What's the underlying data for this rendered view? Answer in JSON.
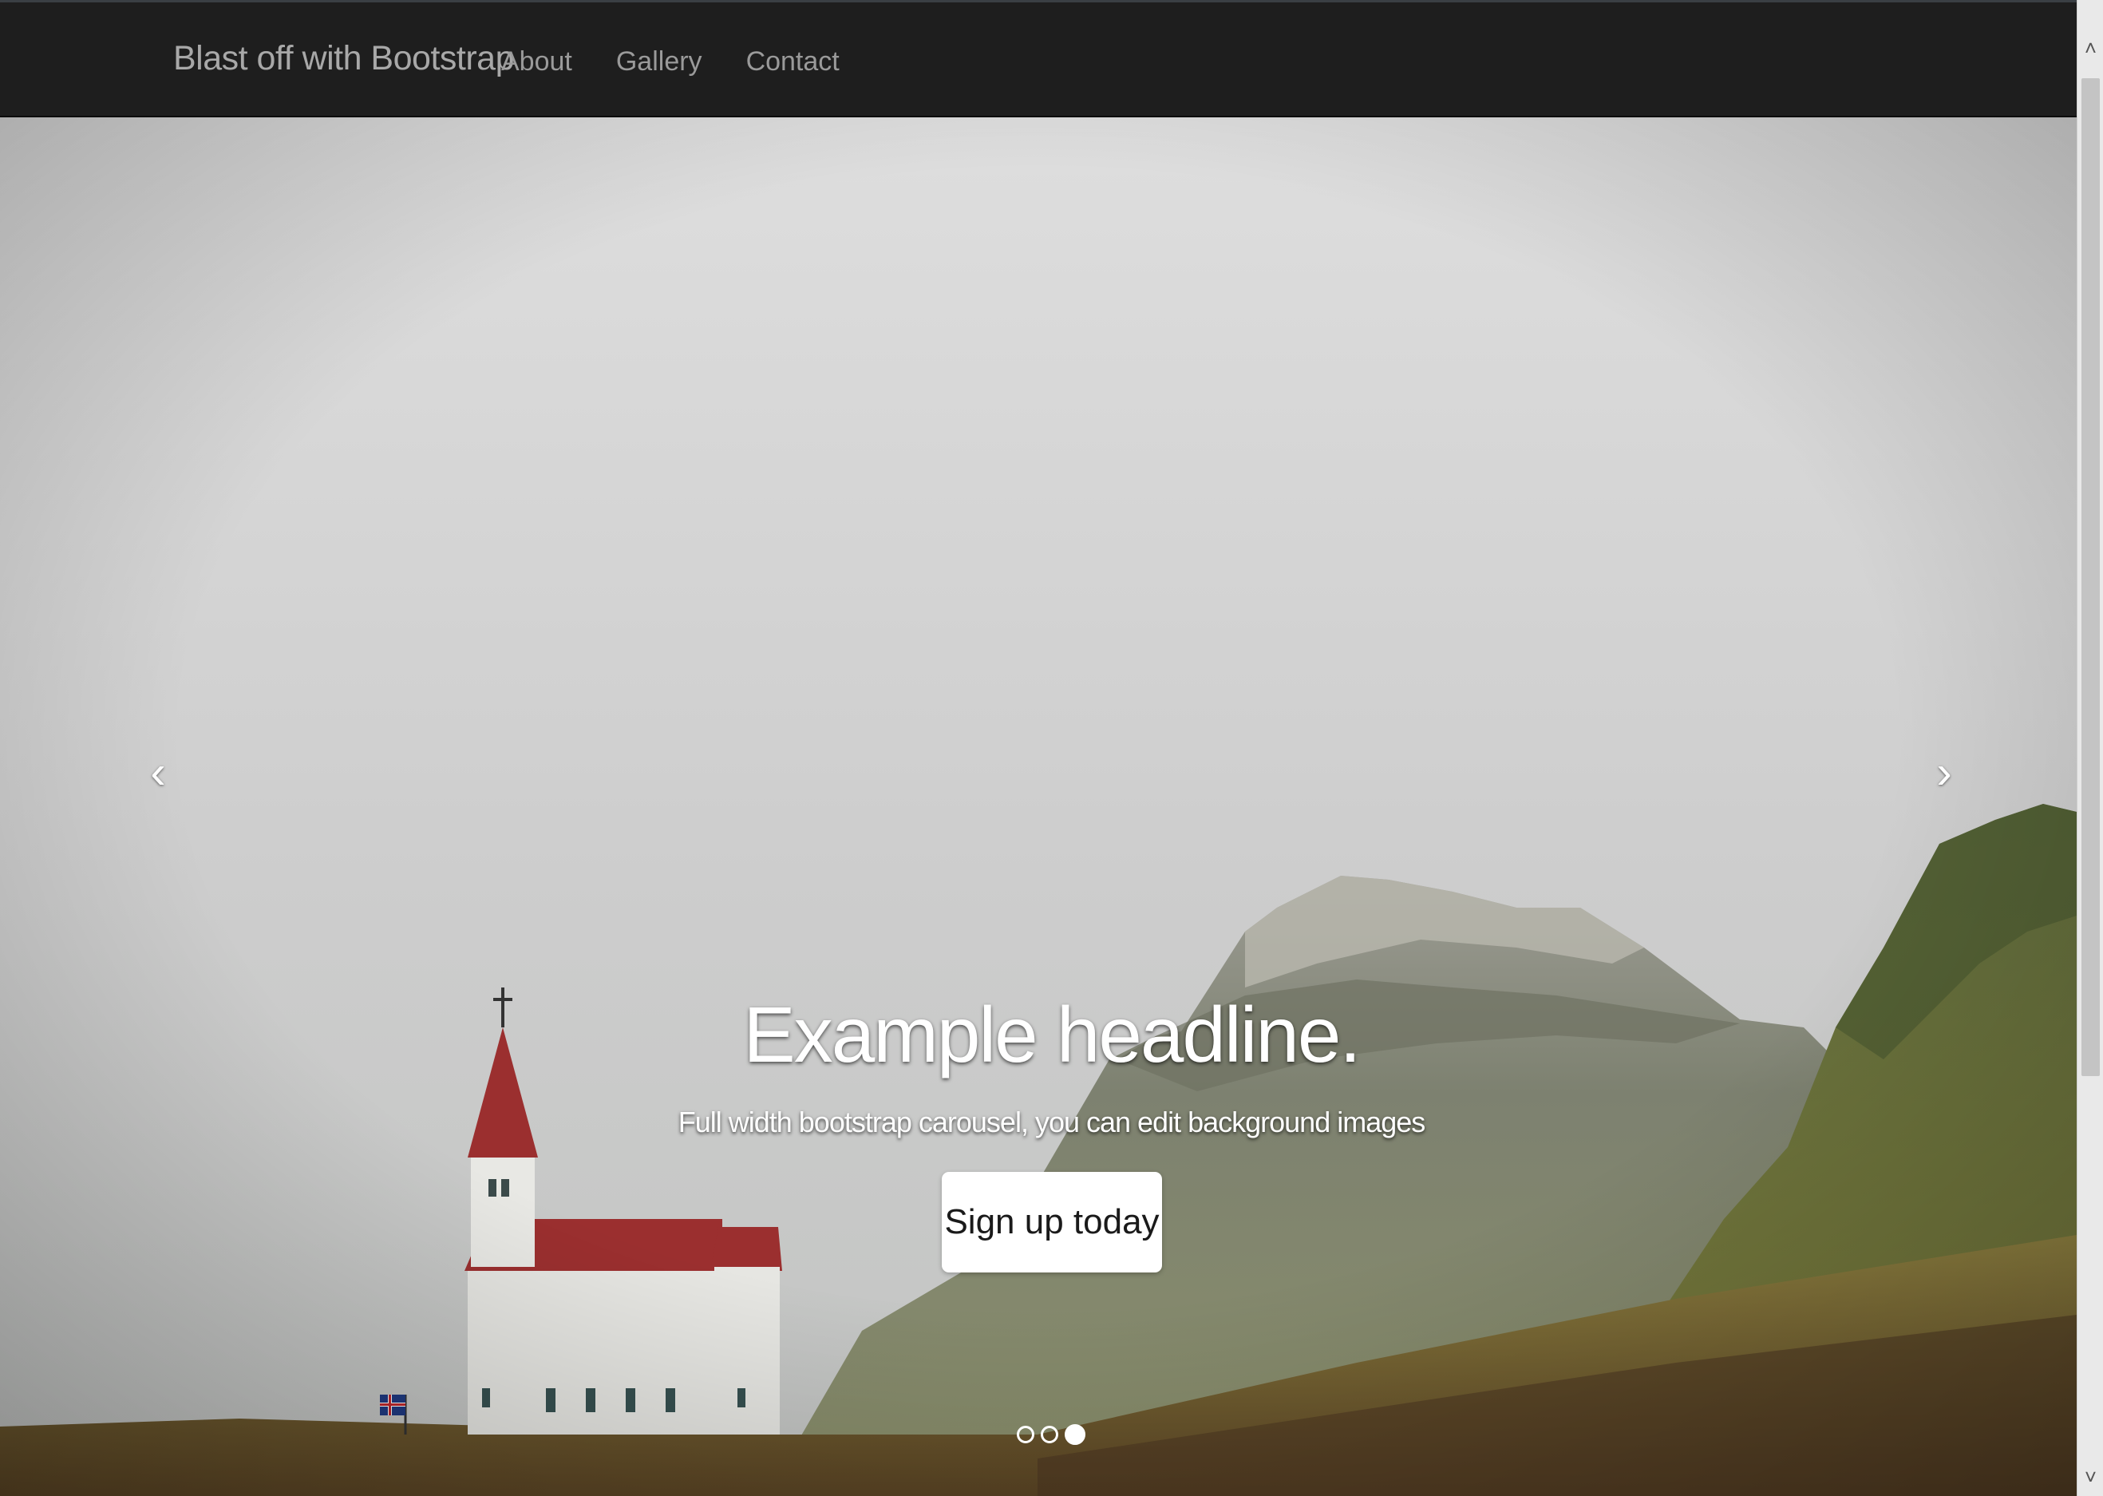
{
  "navbar": {
    "brand": "Blast off with Bootstrap",
    "links": [
      {
        "label": "About"
      },
      {
        "label": "Gallery"
      },
      {
        "label": "Contact"
      }
    ],
    "background": "#1e1e1e"
  },
  "carousel": {
    "headline": "Example headline.",
    "subtext": "Full width bootstrap carousel, you can edit background images",
    "button_label": "Sign up today",
    "prev_icon": "chevron-left-icon",
    "next_icon": "chevron-right-icon",
    "prev_glyph": "‹",
    "next_glyph": "›",
    "slide_count": 3,
    "active_slide": 3
  },
  "scrollbar": {
    "up_glyph": "˄",
    "down_glyph": "˅"
  }
}
